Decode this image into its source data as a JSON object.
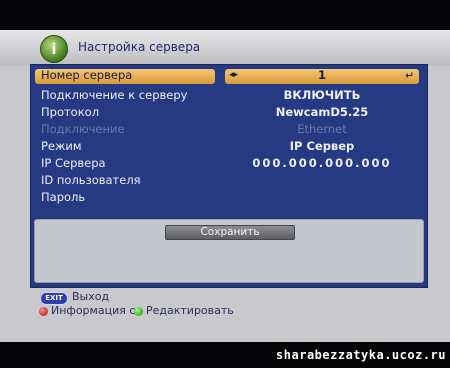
{
  "header": {
    "title": "Настройка сервера",
    "icon": "info-icon",
    "icon_glyph": "i"
  },
  "rows": [
    {
      "label": "Номер сервера",
      "value": "1"
    },
    {
      "label": "Подключение к серверу",
      "value": "ВКЛЮЧИТЬ"
    },
    {
      "label": "Протокол",
      "value": "NewcamD5.25"
    },
    {
      "label": "Подключение",
      "value": "Ethernet"
    },
    {
      "label": "Режим",
      "value": "IP Сервер"
    },
    {
      "label": "IP Сервера",
      "value": "000.000.000.000"
    },
    {
      "label": "ID пользователя",
      "value": ""
    },
    {
      "label": "Пароль",
      "value": ""
    }
  ],
  "save_button": "Сохранить",
  "footer": {
    "exit_badge": "EXIT",
    "exit_label": "Выход",
    "info_label": "Информация о",
    "edit_label": "Редактировать"
  },
  "watermark": "sharabezzatyka.ucoz.ru",
  "colors": {
    "panel": "#253a82",
    "highlight": "#e0a44a",
    "screen_bg": "#c9c9cb"
  }
}
